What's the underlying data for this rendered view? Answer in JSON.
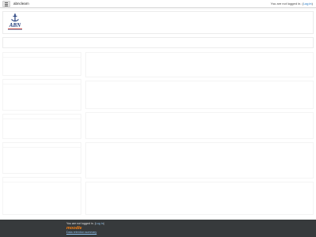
{
  "navbar": {
    "site_name": "abnclearn",
    "login_prefix": "You are not logged in. (",
    "login_link": "Log in",
    "login_suffix": ")"
  },
  "header": {
    "logo_text": "ABN"
  },
  "footer": {
    "login_prefix": "You are not logged in. (",
    "login_link": "Log in",
    "login_suffix": ")",
    "moodle_text": "moodle",
    "data_retention_link": "Data retention summary"
  },
  "colors": {
    "navy": "#1f3a7a",
    "link": "#0f6cbf",
    "footer_bg": "#373a3c",
    "moodle_orange": "#f98012"
  }
}
